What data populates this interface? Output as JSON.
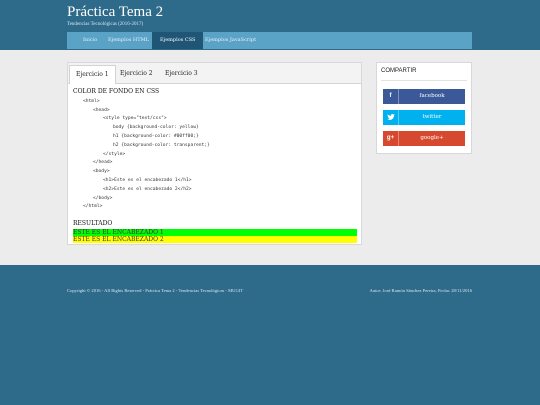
{
  "site": {
    "title": "Práctica Tema 2",
    "subtitle": "Tendencias Tecnológicas (2016-2017)"
  },
  "nav": {
    "items": [
      "Inicio",
      "Ejemplos HTML",
      "Ejemplos CSS",
      "Ejemplos JavaScript"
    ],
    "active": "Ejemplos CSS"
  },
  "main": {
    "tabs": [
      "Ejercicio 1",
      "Ejercicio 2",
      "Ejercicio 3"
    ],
    "active_tab": "Ejercicio 1",
    "section_title": "COLOR DE FONDO EN CSS",
    "code_lines": [
      "<html>",
      "<head>",
      "<style type=\"text/css\">",
      "body {background-color: yellow}",
      "h1 {background-color: #00ff00;}",
      "h2 {background-color: transparent;}",
      "</style>",
      "</head>",
      "<body>",
      "<h1>Este es el encabezado 1</h1>",
      "<h2>Este es el encabezado 2</h2>",
      "</body>",
      "</html>"
    ],
    "result_label": "RESULTADO",
    "result_h1": "ESTE ES EL ENCABEZADO 1",
    "result_h2": "ESTE ES EL ENCABEZADO 2",
    "result_h1_bg": "#00ff00",
    "result_h2_bg": "#ffff00"
  },
  "share": {
    "title": "COMPARTIR",
    "buttons": [
      {
        "label": "facebook",
        "icon": "facebook-icon",
        "color": "#3b5998"
      },
      {
        "label": "twitter",
        "icon": "twitter-icon",
        "color": "#00b1f0"
      },
      {
        "label": "google+",
        "icon": "google-plus-icon",
        "color": "#d6492f"
      }
    ]
  },
  "footer": {
    "left": "Copyright © 2016 - All Rights Reserved - Práctica Tema 2 - Tendencias Tecnológicas - MUGIT",
    "right": "Autor: José Ramón Sánchez Pereira, Fecha: 28/11/2016"
  },
  "colors": {
    "page_bg": "#2e6b8a",
    "nav_bg": "#5aa2c6",
    "nav_active": "#1f5676",
    "content_bg": "#ececec"
  }
}
